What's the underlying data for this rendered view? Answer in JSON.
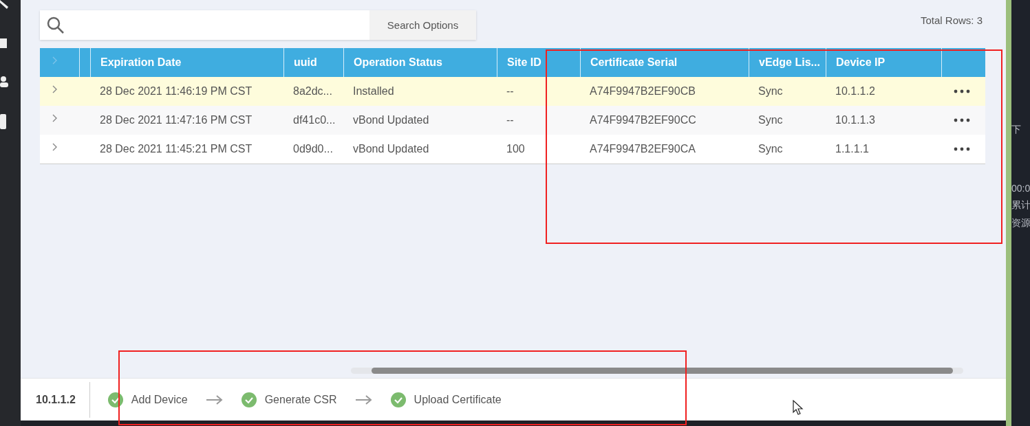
{
  "search": {
    "button": "Search Options"
  },
  "total_rows": "Total Rows: 3",
  "table": {
    "columns": [
      "Expiration Date",
      "uuid",
      "Operation Status",
      "Site ID",
      "Certificate Serial",
      "vEdge Lis...",
      "Device IP"
    ],
    "rows": [
      {
        "selected": true,
        "cells": [
          "28 Dec 2021 11:46:19 PM CST",
          "8a2dc...",
          "Installed",
          "--",
          "A74F9947B2EF90CB",
          "Sync",
          "10.1.1.2"
        ]
      },
      {
        "selected": false,
        "cells": [
          "28 Dec 2021 11:47:16 PM CST",
          "df41c0...",
          "vBond Updated",
          "--",
          "A74F9947B2EF90CC",
          "Sync",
          "10.1.1.3"
        ]
      },
      {
        "selected": false,
        "cells": [
          "28 Dec 2021 11:45:21 PM CST",
          "0d9d0...",
          "vBond Updated",
          "100",
          "A74F9947B2EF90CA",
          "Sync",
          "1.1.1.1"
        ]
      }
    ]
  },
  "footer": {
    "device": "10.1.1.2",
    "steps": [
      {
        "label": "Add Device",
        "done": true
      },
      {
        "label": "Generate CSR",
        "done": true
      },
      {
        "label": "Upload Certificate",
        "done": true
      }
    ]
  },
  "side_panel": {
    "texts": [
      "下",
      "00:0",
      "累计",
      "资源"
    ]
  }
}
